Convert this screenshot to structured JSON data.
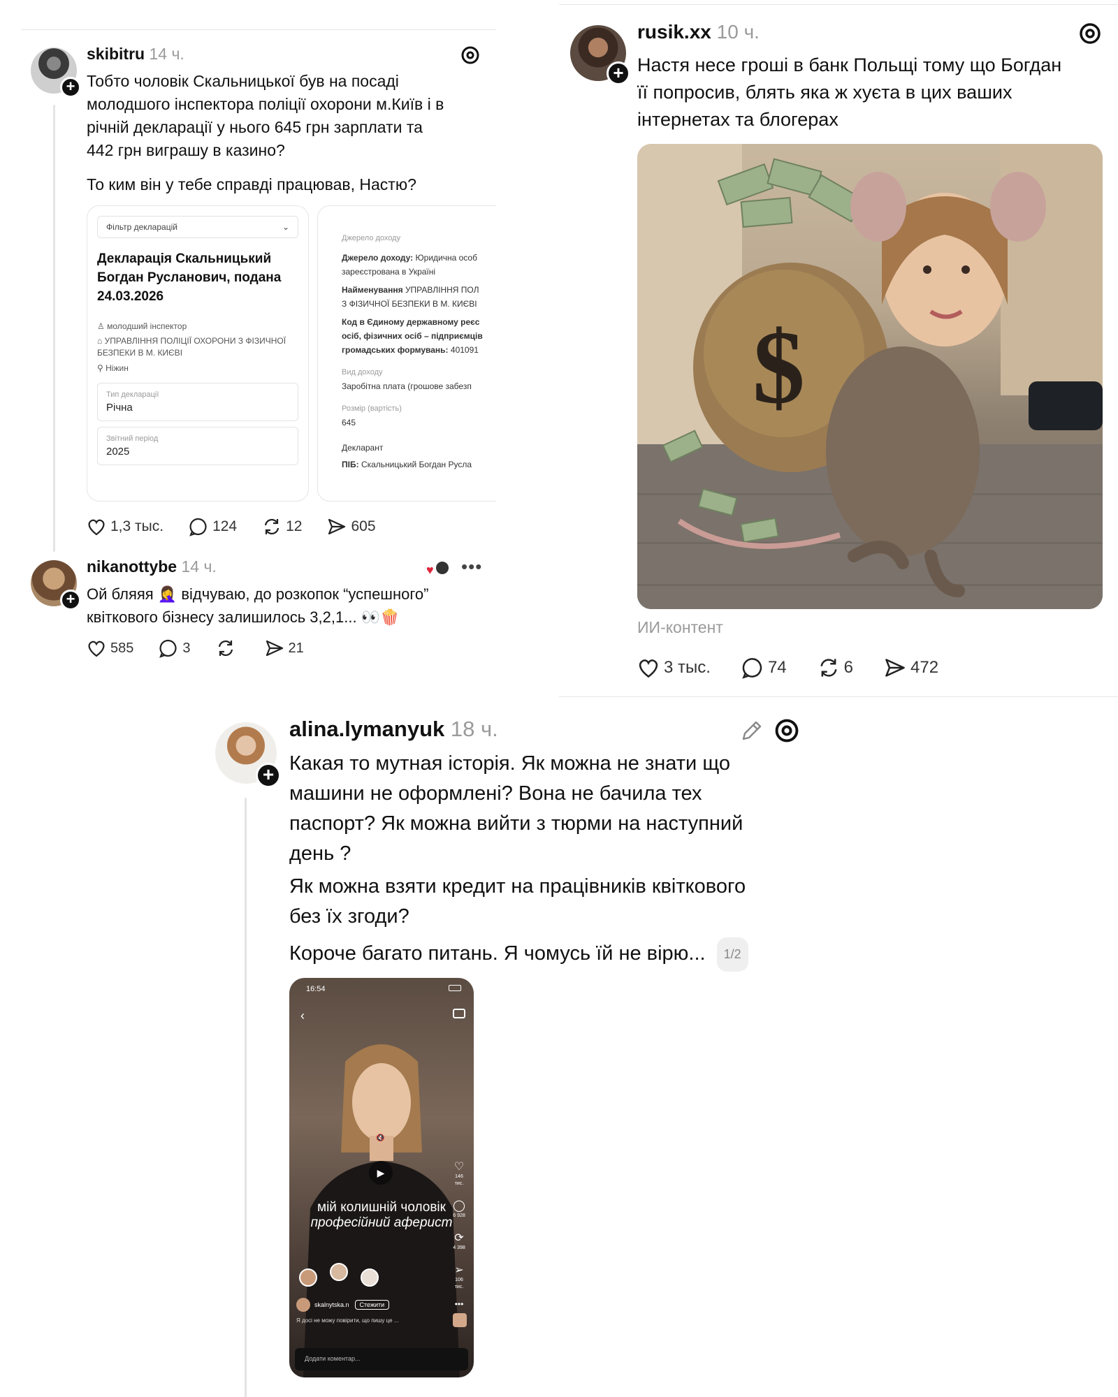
{
  "post1": {
    "username": "skibitru",
    "time": "14 ч.",
    "text_line1": "Тобто чоловік Скальницької був на посаді",
    "text_line2": "молодшого інспектора поліції охорони м.Київ і в",
    "text_line3": "річній декларації у нього 645 грн зарплати та",
    "text_line4": "442 грн виграшу в казино?",
    "text_line5": "То ким він у тебе справді працював, Настю?",
    "card1": {
      "filter": "Фільтр декларацій",
      "title": "Декларація Скальницький Богдан Русланович, подана 24.03.2026",
      "meta1": "молодший інспектор",
      "meta2": "УПРАВЛІННЯ ПОЛІЦІЇ ОХОРОНИ З ФІЗИЧНОЇ БЕЗПЕКИ В М. КИЄВІ",
      "meta3": "Ніжин",
      "type_label": "Тип декларації",
      "type_value": "Річна",
      "period_label": "Звітний період",
      "period_value": "2025"
    },
    "card2": {
      "section": "Джерело доходу",
      "src_label": "Джерело доходу:",
      "src_value": "Юридична особ",
      "src_value2": "зареєстрована в Україні",
      "name_label": "Найменування",
      "name_value": "УПРАВЛІННЯ ПОЛ",
      "name_value2": "З ФІЗИЧНОЇ БЕЗПЕКИ В М. КИЄВІ",
      "code_label": "Код в Єдиному державному реєс",
      "code_label2": "осіб, фізичних осіб – підприємців",
      "code_label3": "громадських формувань:",
      "code_value": "401091",
      "kind_label": "Вид доходу",
      "kind_value": "Заробітна плата (грошове забезп",
      "size_label": "Розмір (вартість)",
      "size_value": "645",
      "declarant": "Декларант",
      "pib_label": "ПІБ:",
      "pib_value": "Скальницький Богдан Русла"
    },
    "likes": "1,3 тыс.",
    "comments": "124",
    "reposts": "12",
    "shares": "605"
  },
  "reply1": {
    "username": "nikanottybe",
    "time": "14 ч.",
    "text_line1": "Ой бляяя 🤦‍♀️ відчуваю, до розкопок “успешного”",
    "text_line2": "квіткового бізнесу залишилось 3,2,1... 👀🍿",
    "likes": "585",
    "comments": "3",
    "shares": "21"
  },
  "post2": {
    "username": "rusik.xx",
    "time": "10 ч.",
    "text_line1": "Настя несе гроші в банк Польщі тому що Богдан",
    "text_line2": "її попросив, блять яка ж хуєта в цих ваших",
    "text_line3": "інтернетах та блогерах",
    "ai_label": "ИИ-контент",
    "likes": "3 тыс.",
    "comments": "74",
    "reposts": "6",
    "shares": "472"
  },
  "post3": {
    "username": "alina.lymanyuk",
    "time": "18 ч.",
    "text_line1": "Какая то мутная історія. Як можна  не знати що",
    "text_line2": "машини не оформлені? Вона не бачила тех",
    "text_line3": "паспорт? Як можна вийти з тюрми на наступний",
    "text_line4": "день ?",
    "text_line5": "Як можна взяти кредит на працівників квіткового",
    "text_line6": "без їх згоди?",
    "text_line7": "Короче багато питань. Я чомусь їй не вірю...",
    "pager": "1/2",
    "phone": {
      "clock": "16:54",
      "caption_line1": "мій колишній чоловік",
      "caption_line2": "професійний аферист",
      "like_count": "146 тис.",
      "comment_count": "6 928",
      "repost_count": "4 398",
      "share_count": "106 тис.",
      "author": "skalnytska.n",
      "follow": "Стежити",
      "desc": "Я досі не можу повірити, що пишу це ...",
      "comment_placeholder": "Додати коментар..."
    }
  }
}
